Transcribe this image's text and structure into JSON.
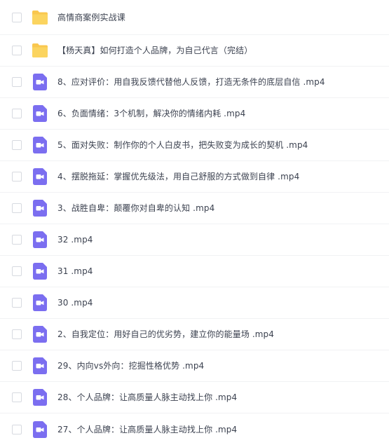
{
  "files": [
    {
      "type": "folder",
      "name": "高情商案例实战课"
    },
    {
      "type": "folder",
      "name": "【杨天真】如何打造个人品牌，为自己代言（完结）"
    },
    {
      "type": "video",
      "name": "8、应对评价：用自我反馈代替他人反馈，打造无条件的底层自信 .mp4"
    },
    {
      "type": "video",
      "name": "6、负面情绪：3个机制，解决你的情绪内耗 .mp4"
    },
    {
      "type": "video",
      "name": "5、面对失败：制作你的个人白皮书，把失败变为成长的契机 .mp4"
    },
    {
      "type": "video",
      "name": "4、摆脱拖延：掌握优先级法，用自己舒服的方式做到自律 .mp4"
    },
    {
      "type": "video",
      "name": "3、战胜自卑：颠覆你对自卑的认知 .mp4"
    },
    {
      "type": "video",
      "name": "32 .mp4"
    },
    {
      "type": "video",
      "name": "31 .mp4"
    },
    {
      "type": "video",
      "name": "30 .mp4"
    },
    {
      "type": "video",
      "name": "2、自我定位：用好自己的优劣势，建立你的能量场 .mp4"
    },
    {
      "type": "video",
      "name": "29、内向vs外向：挖掘性格优势 .mp4"
    },
    {
      "type": "video",
      "name": "28、个人品牌：让高质量人脉主动找上你 .mp4"
    },
    {
      "type": "video",
      "name": "27、个人品牌：让高质量人脉主动找上你 .mp4"
    }
  ],
  "colors": {
    "folder": "#f9c74f",
    "video": "#7b6ef0",
    "checkbox_border": "#d7dae0",
    "row_divider": "#f1f2f4",
    "text": "#3c4250"
  },
  "icons": {
    "folder": "folder-icon",
    "video": "video-file-icon"
  }
}
